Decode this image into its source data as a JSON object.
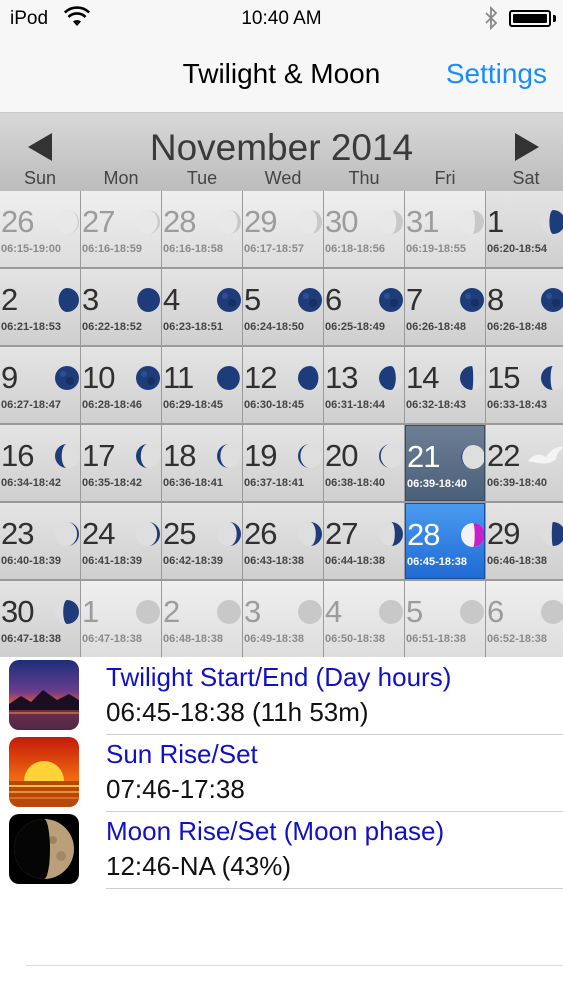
{
  "status_bar": {
    "carrier": "iPod",
    "time": "10:40 AM"
  },
  "nav": {
    "title": "Twilight & Moon",
    "settings_label": "Settings"
  },
  "calendar": {
    "month_title": "November 2014",
    "weekdays": [
      "Sun",
      "Mon",
      "Tue",
      "Wed",
      "Thu",
      "Fri",
      "Sat"
    ],
    "days": [
      {
        "day": "26",
        "hours": "06:15-19:00",
        "other": true,
        "phase": 0.05
      },
      {
        "day": "27",
        "hours": "06:16-18:59",
        "other": true,
        "phase": 0.1
      },
      {
        "day": "28",
        "hours": "06:16-18:58",
        "other": true,
        "phase": 0.15
      },
      {
        "day": "29",
        "hours": "06:17-18:57",
        "other": true,
        "phase": 0.2
      },
      {
        "day": "30",
        "hours": "06:18-18:56",
        "other": true,
        "phase": 0.28
      },
      {
        "day": "31",
        "hours": "06:19-18:55",
        "other": true,
        "phase": 0.38
      },
      {
        "day": "1",
        "hours": "06:20-18:54",
        "other": false,
        "phase": 0.65
      },
      {
        "day": "2",
        "hours": "06:21-18:53",
        "other": false,
        "phase": 0.85
      },
      {
        "day": "3",
        "hours": "06:22-18:52",
        "other": false,
        "phase": 0.95
      },
      {
        "day": "4",
        "hours": "06:23-18:51",
        "other": false,
        "phase": 1.0
      },
      {
        "day": "5",
        "hours": "06:24-18:50",
        "other": false,
        "phase": 1.0
      },
      {
        "day": "6",
        "hours": "06:25-18:49",
        "other": false,
        "phase": 1.0
      },
      {
        "day": "7",
        "hours": "06:26-18:48",
        "other": false,
        "phase": 1.0
      },
      {
        "day": "8",
        "hours": "06:26-18:48",
        "other": false,
        "phase": 1.0
      },
      {
        "day": "9",
        "hours": "06:27-18:47",
        "other": false,
        "phase": 1.0
      },
      {
        "day": "10",
        "hours": "06:28-18:46",
        "other": false,
        "phase": 1.0
      },
      {
        "day": "11",
        "hours": "06:29-18:45",
        "other": false,
        "phase": 0.95
      },
      {
        "day": "12",
        "hours": "06:30-18:45",
        "other": false,
        "phase": 0.85
      },
      {
        "day": "13",
        "hours": "06:31-18:44",
        "other": false,
        "phase": 0.7
      },
      {
        "day": "14",
        "hours": "06:32-18:43",
        "other": false,
        "phase": 0.55
      },
      {
        "day": "15",
        "hours": "06:33-18:43",
        "other": false,
        "phase": 0.4
      },
      {
        "day": "16",
        "hours": "06:34-18:42",
        "other": false,
        "phase": 0.28
      },
      {
        "day": "17",
        "hours": "06:35-18:42",
        "other": false,
        "phase": 0.2
      },
      {
        "day": "18",
        "hours": "06:36-18:41",
        "other": false,
        "phase": 0.14
      },
      {
        "day": "19",
        "hours": "06:37-18:41",
        "other": false,
        "phase": 0.1
      },
      {
        "day": "20",
        "hours": "06:38-18:40",
        "other": false,
        "phase": 0.07
      },
      {
        "day": "21",
        "hours": "06:39-18:40",
        "other": false,
        "phase": 0.05,
        "selected": true
      },
      {
        "day": "22",
        "hours": "06:39-18:40",
        "other": false,
        "phase": 0.0
      },
      {
        "day": "23",
        "hours": "06:40-18:39",
        "other": false,
        "phase": 0.08
      },
      {
        "day": "24",
        "hours": "06:41-18:39",
        "other": false,
        "phase": 0.12
      },
      {
        "day": "25",
        "hours": "06:42-18:39",
        "other": false,
        "phase": 0.18
      },
      {
        "day": "26",
        "hours": "06:43-18:38",
        "other": false,
        "phase": 0.26
      },
      {
        "day": "27",
        "hours": "06:44-18:38",
        "other": false,
        "phase": 0.34
      },
      {
        "day": "28",
        "hours": "06:45-18:38",
        "other": false,
        "phase": 0.43,
        "today": true
      },
      {
        "day": "29",
        "hours": "06:46-18:38",
        "other": false,
        "phase": 0.55
      },
      {
        "day": "30",
        "hours": "06:47-18:38",
        "other": false,
        "phase": 0.66
      },
      {
        "day": "1",
        "hours": "06:47-18:38",
        "other": true,
        "phase": 1.0
      },
      {
        "day": "2",
        "hours": "06:48-18:38",
        "other": true,
        "phase": 1.0
      },
      {
        "day": "3",
        "hours": "06:49-18:38",
        "other": true,
        "phase": 1.0
      },
      {
        "day": "4",
        "hours": "06:50-18:38",
        "other": true,
        "phase": 1.0
      },
      {
        "day": "5",
        "hours": "06:51-18:38",
        "other": true,
        "phase": 1.0
      },
      {
        "day": "6",
        "hours": "06:52-18:38",
        "other": true,
        "phase": 1.0
      }
    ]
  },
  "info": [
    {
      "label": "Twilight Start/End (Day hours)",
      "value": "06:45-18:38 (11h 53m)",
      "icon": "twilight-icon"
    },
    {
      "label": "Sun Rise/Set",
      "value": "07:46-17:38",
      "icon": "sunset-icon"
    },
    {
      "label": "Moon Rise/Set (Moon phase)",
      "value": "12:46-NA (43%)",
      "icon": "moon-phase-icon"
    }
  ],
  "colors": {
    "accent": "#1a8ef8",
    "info_label": "#1010c8",
    "today": "#1f6ad4"
  }
}
